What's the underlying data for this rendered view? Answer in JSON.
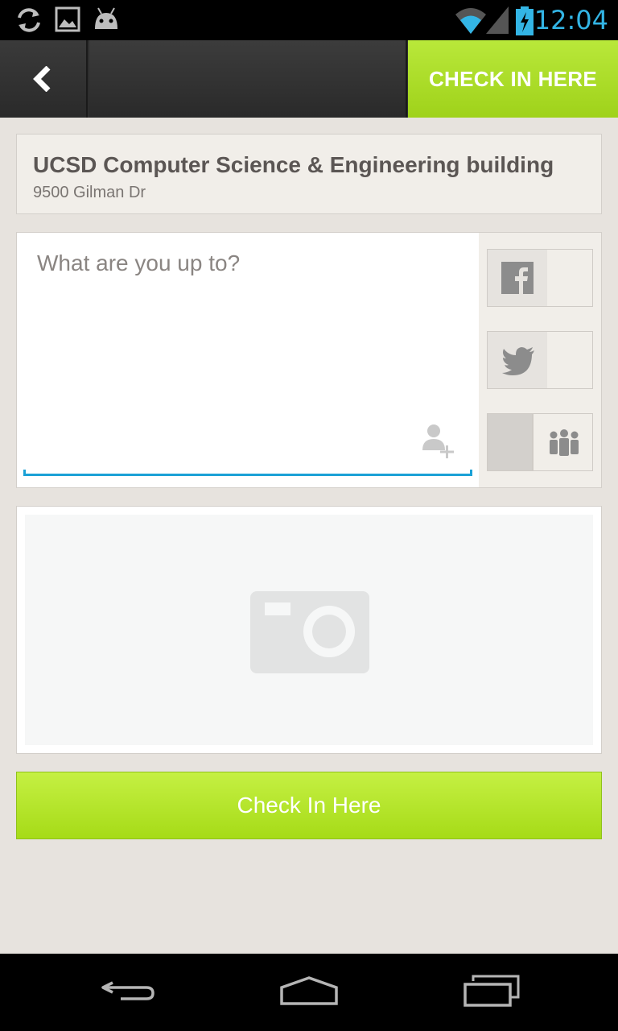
{
  "status_bar": {
    "time": "12:04",
    "icons": [
      "sync-icon",
      "image-icon",
      "android-icon",
      "wifi-icon",
      "signal-icon",
      "battery-charging-icon"
    ]
  },
  "action_bar": {
    "back_icon": "chevron-left-icon",
    "check_in_label": "CHECK IN HERE"
  },
  "venue": {
    "name": "UCSD Computer Science & Engineering building",
    "address": "9500 Gilman Dr"
  },
  "comment": {
    "placeholder": "What are you up to?",
    "tag_icon": "add-person-icon"
  },
  "share": {
    "facebook_icon": "facebook-icon",
    "twitter_icon": "twitter-icon",
    "friends_icon": "friends-icon"
  },
  "photo": {
    "icon": "camera-icon"
  },
  "check_in_button": {
    "label": "Check In Here"
  },
  "nav_bar": {
    "icons": [
      "back-icon",
      "home-icon",
      "recents-icon"
    ]
  },
  "colors": {
    "accent_green": "#a6db17",
    "focus_blue": "#1ba1d6",
    "status_blue": "#33b5e5"
  }
}
